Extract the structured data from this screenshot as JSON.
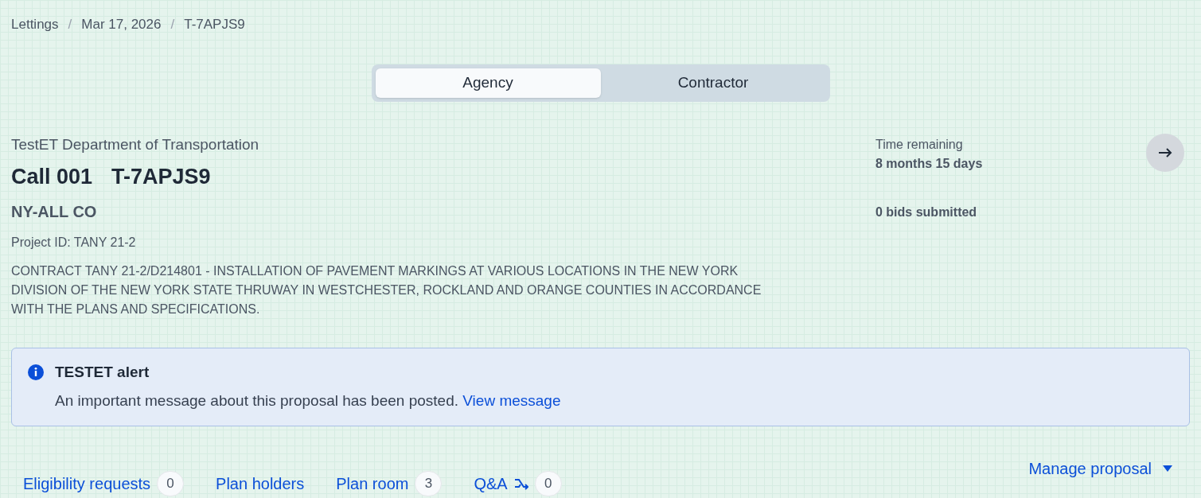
{
  "breadcrumbs": [
    "Lettings",
    "Mar 17, 2026",
    "T-7APJS9"
  ],
  "breadcrumb_separator": "/",
  "view_toggle": [
    {
      "label": "Agency",
      "selected": true
    },
    {
      "label": "Contractor",
      "selected": false
    }
  ],
  "header": {
    "agency": "TestET Department of Transportation",
    "call": "Call 001",
    "proposal": "T-7APJS9",
    "county": "NY-ALL CO",
    "project_id": "Project ID: TANY 21-2",
    "description": "CONTRACT TANY 21-2/D214801 - INSTALLATION OF PAVEMENT MARKINGS AT VARIOUS LOCATIONS IN THE NEW YORK DIVISION OF THE NEW YORK STATE THRUWAY IN WESTCHESTER, ROCKLAND AND ORANGE COUNTIES IN ACCORDANCE WITH THE PLANS AND SPECIFICATIONS."
  },
  "status": {
    "time_label": "Time remaining",
    "time_value": "8 months 15 days",
    "bids": "0 bids submitted"
  },
  "alert": {
    "title": "TESTET alert",
    "message": "An important message about this proposal has been posted.",
    "link": "View message"
  },
  "nav_links": [
    {
      "label": "Eligibility requests",
      "count": "0",
      "kind": "plain"
    },
    {
      "label": "Plan holders",
      "kind": "plain"
    },
    {
      "label": "Plan room",
      "count": "3",
      "kind": "plain"
    },
    {
      "label": "Q&A",
      "count": "0",
      "kind": "linked"
    }
  ],
  "manage": "Manage proposal"
}
